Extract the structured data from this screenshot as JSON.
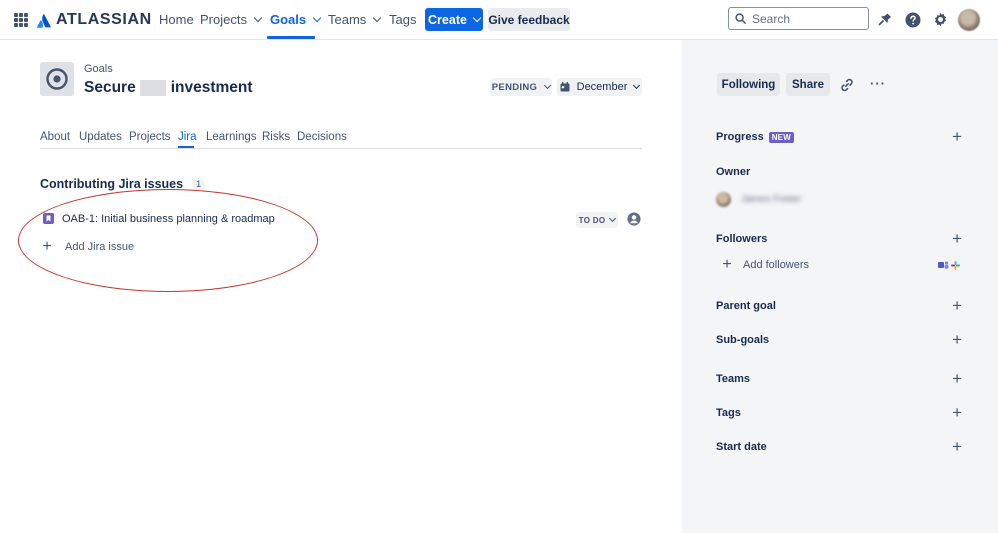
{
  "topnav": {
    "brand": "ATLASSIAN",
    "items": [
      {
        "label": "Home"
      },
      {
        "label": "Projects"
      },
      {
        "label": "Goals"
      },
      {
        "label": "Teams"
      },
      {
        "label": "Tags"
      }
    ],
    "active_item": "Goals",
    "create_label": "Create",
    "feedback_label": "Give feedback",
    "search_placeholder": "Search",
    "accent_color": "#0c66e4"
  },
  "goal": {
    "breadcrumb": "Goals",
    "title_prefix": "Secure",
    "title_suffix": "investment",
    "status": "PENDING",
    "target_date": "December"
  },
  "tabs": [
    {
      "label": "About"
    },
    {
      "label": "Updates"
    },
    {
      "label": "Projects"
    },
    {
      "label": "Jira"
    },
    {
      "label": "Learnings"
    },
    {
      "label": "Risks"
    },
    {
      "label": "Decisions"
    }
  ],
  "active_tab": "Jira",
  "jira": {
    "section_title": "Contributing Jira issues",
    "count": "1",
    "issues": [
      {
        "key_title": "OAB-1: Initial business planning & roadmap",
        "status": "TO DO"
      }
    ],
    "add_label": "Add Jira issue"
  },
  "sidebar": {
    "following_label": "Following",
    "share_label": "Share",
    "more_label": "···",
    "progress_label": "Progress",
    "new_badge": "NEW",
    "owner_label": "Owner",
    "owner_name": "James Foster",
    "followers_label": "Followers",
    "add_followers_label": "Add followers",
    "parent_goal_label": "Parent goal",
    "sub_goals_label": "Sub-goals",
    "teams_label": "Teams",
    "tags_label": "Tags",
    "start_date_label": "Start date"
  },
  "colors": {
    "annotation": "#c0392b",
    "story_icon": "#6e5dc6",
    "side_panel": "#f4f5f7"
  },
  "icons": [
    "app-switcher-icon",
    "atlassian-logo-icon",
    "search-icon",
    "notification-icon",
    "help-icon",
    "settings-icon",
    "goal-target-icon",
    "calendar-icon",
    "story-icon",
    "assignee-icon",
    "plus-icon",
    "link-icon",
    "teams-app-icon",
    "slack-app-icon"
  ]
}
